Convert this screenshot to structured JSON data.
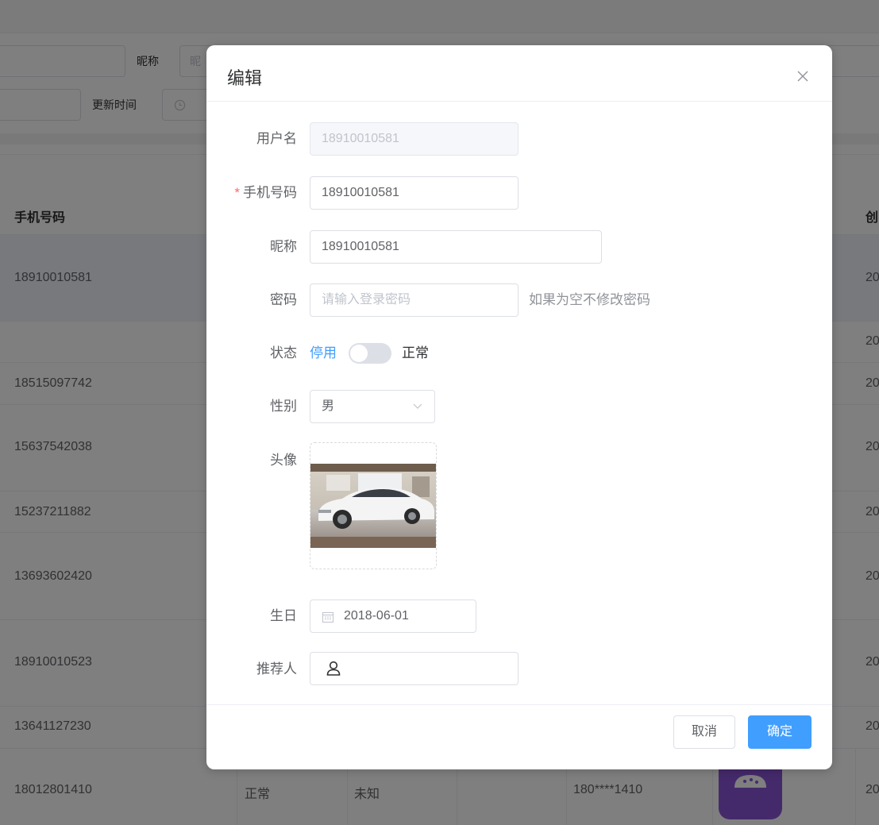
{
  "background": {
    "search": {
      "nickname_label": "昵称",
      "nickname_placeholder": "昵",
      "update_time_label": "更新时间"
    },
    "table": {
      "phone_header": "手机号码",
      "right_header": "创",
      "rows": [
        {
          "phone": "18910010581",
          "right": "20"
        },
        {
          "phone": "",
          "right": "20"
        },
        {
          "phone": "18515097742",
          "right": "20"
        },
        {
          "phone": "15637542038",
          "right": "20"
        },
        {
          "phone": "15237211882",
          "right": "20"
        },
        {
          "phone": "13693602420",
          "right": "20"
        },
        {
          "phone": "18910010523",
          "right": "20"
        },
        {
          "phone": "13641127230",
          "right": "20"
        },
        {
          "phone": "18012801410",
          "status": "正常",
          "gender": "未知",
          "masked": "180****1410",
          "right": "20"
        }
      ]
    }
  },
  "dialog": {
    "title": "编辑",
    "fields": {
      "username": {
        "label": "用户名",
        "value": "18910010581"
      },
      "phone": {
        "label": "手机号码",
        "required_mark": "*",
        "value": "18910010581"
      },
      "nickname": {
        "label": "昵称",
        "value": "18910010581"
      },
      "password": {
        "label": "密码",
        "placeholder": "请输入登录密码",
        "hint": "如果为空不修改密码"
      },
      "status": {
        "label": "状态",
        "inactive_text": "停用",
        "active_text": "正常",
        "on": false
      },
      "gender": {
        "label": "性别",
        "value": "男"
      },
      "avatar": {
        "label": "头像"
      },
      "birthday": {
        "label": "生日",
        "value": "2018-06-01"
      },
      "referrer": {
        "label": "推荐人",
        "value": ""
      }
    },
    "buttons": {
      "cancel": "取消",
      "confirm": "确定"
    }
  },
  "colors": {
    "primary": "#409eff",
    "required": "#f56c6c",
    "avatar_bg": "#8b55d6"
  },
  "icons": [
    "clock-icon",
    "close-icon",
    "chevron-down-icon",
    "calendar-icon",
    "user-icon"
  ]
}
